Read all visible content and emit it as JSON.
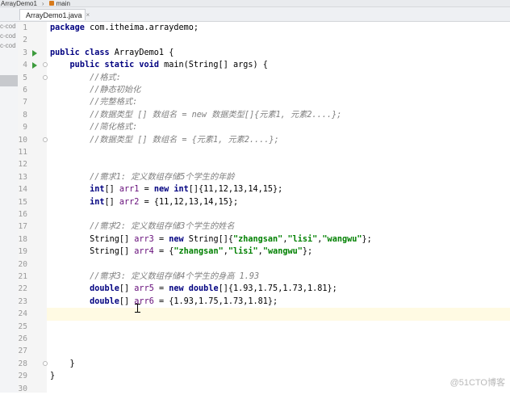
{
  "breadcrumb": {
    "file": "ArrayDemo1",
    "method": "main"
  },
  "tab": {
    "label": "ArrayDemo1.java",
    "close": "×"
  },
  "project_panel": {
    "items": [
      "c-cod",
      "c-cod",
      "c-cod"
    ]
  },
  "editor": {
    "lines": [
      {
        "n": "1",
        "segs": [
          [
            "kw",
            "package "
          ],
          [
            "",
            "com.itheima.arraydemo;"
          ]
        ]
      },
      {
        "n": "2",
        "segs": []
      },
      {
        "n": "3",
        "run": true,
        "segs": [
          [
            "kw",
            "public class "
          ],
          [
            "",
            "ArrayDemo1 {"
          ]
        ]
      },
      {
        "n": "4",
        "run": true,
        "fold": true,
        "segs": [
          [
            "",
            "    "
          ],
          [
            "kw",
            "public static void "
          ],
          [
            "",
            "main(String[] args) {"
          ]
        ]
      },
      {
        "n": "5",
        "fold": true,
        "segs": [
          [
            "",
            "        "
          ],
          [
            "cm",
            "//格式:"
          ]
        ]
      },
      {
        "n": "6",
        "segs": [
          [
            "",
            "        "
          ],
          [
            "cm",
            "//静态初始化"
          ]
        ]
      },
      {
        "n": "7",
        "segs": [
          [
            "",
            "        "
          ],
          [
            "cm",
            "//完整格式:"
          ]
        ]
      },
      {
        "n": "8",
        "segs": [
          [
            "",
            "        "
          ],
          [
            "cm",
            "//数据类型 [] 数组名 = new 数据类型[]{元素1, 元素2....};"
          ]
        ]
      },
      {
        "n": "9",
        "segs": [
          [
            "",
            "        "
          ],
          [
            "cm",
            "//简化格式:"
          ]
        ]
      },
      {
        "n": "10",
        "fold": true,
        "segs": [
          [
            "",
            "        "
          ],
          [
            "cm",
            "//数据类型 [] 数组名 = {元素1, 元素2....};"
          ]
        ]
      },
      {
        "n": "11",
        "segs": []
      },
      {
        "n": "12",
        "segs": []
      },
      {
        "n": "13",
        "segs": [
          [
            "",
            "        "
          ],
          [
            "cm",
            "//需求1: 定义数组存储5个学生的年龄"
          ]
        ]
      },
      {
        "n": "14",
        "segs": [
          [
            "",
            "        "
          ],
          [
            "kw",
            "int"
          ],
          [
            "",
            "[] "
          ],
          [
            "var",
            "arr1"
          ],
          [
            "",
            " = "
          ],
          [
            "kw",
            "new int"
          ],
          [
            "",
            "[]{11,12,13,14,15};"
          ]
        ]
      },
      {
        "n": "15",
        "segs": [
          [
            "",
            "        "
          ],
          [
            "kw",
            "int"
          ],
          [
            "",
            "[] "
          ],
          [
            "var",
            "arr2"
          ],
          [
            "",
            " = {11,12,13,14,15};"
          ]
        ]
      },
      {
        "n": "16",
        "segs": []
      },
      {
        "n": "17",
        "segs": [
          [
            "",
            "        "
          ],
          [
            "cm",
            "//需求2: 定义数组存储3个学生的姓名"
          ]
        ]
      },
      {
        "n": "18",
        "segs": [
          [
            "",
            "        String[] "
          ],
          [
            "var",
            "arr3"
          ],
          [
            "",
            " = "
          ],
          [
            "kw",
            "new "
          ],
          [
            "",
            "String[]{"
          ],
          [
            "str",
            "\"zhangsan\""
          ],
          [
            "",
            ","
          ],
          [
            "str",
            "\"lisi\""
          ],
          [
            "",
            ","
          ],
          [
            "str",
            "\"wangwu\""
          ],
          [
            "",
            "};"
          ]
        ]
      },
      {
        "n": "19",
        "segs": [
          [
            "",
            "        String[] "
          ],
          [
            "var",
            "arr4"
          ],
          [
            "",
            " = {"
          ],
          [
            "str",
            "\"zhangsan\""
          ],
          [
            "",
            ","
          ],
          [
            "str",
            "\"lisi\""
          ],
          [
            "",
            ","
          ],
          [
            "str",
            "\"wangwu\""
          ],
          [
            "",
            "};"
          ]
        ]
      },
      {
        "n": "20",
        "segs": []
      },
      {
        "n": "21",
        "segs": [
          [
            "",
            "        "
          ],
          [
            "cm",
            "//需求3: 定义数组存储4个学生的身高 1.93"
          ]
        ]
      },
      {
        "n": "22",
        "segs": [
          [
            "",
            "        "
          ],
          [
            "kw",
            "double"
          ],
          [
            "",
            "[] "
          ],
          [
            "var",
            "arr5"
          ],
          [
            "",
            " = "
          ],
          [
            "kw",
            "new double"
          ],
          [
            "",
            "[]{1.93,1.75,1.73,1.81};"
          ]
        ]
      },
      {
        "n": "23",
        "segs": [
          [
            "",
            "        "
          ],
          [
            "kw",
            "double"
          ],
          [
            "",
            "[] "
          ],
          [
            "var",
            "arr6"
          ],
          [
            "",
            " = {1.93,1.75,1.73,1.81};"
          ]
        ]
      },
      {
        "n": "24",
        "caret": true,
        "segs": []
      },
      {
        "n": "25",
        "segs": []
      },
      {
        "n": "26",
        "segs": []
      },
      {
        "n": "27",
        "segs": []
      },
      {
        "n": "28",
        "fold": true,
        "segs": [
          [
            "",
            "    }"
          ]
        ]
      },
      {
        "n": "29",
        "segs": [
          [
            "",
            "}"
          ]
        ]
      },
      {
        "n": "30",
        "segs": []
      }
    ]
  },
  "watermark": "@51CTO博客"
}
